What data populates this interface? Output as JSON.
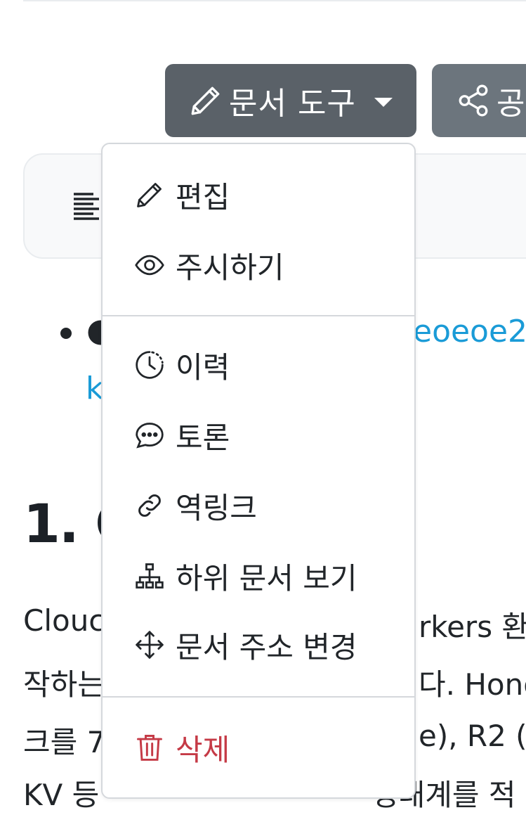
{
  "toolbar": {
    "doc_tools_label": "문서 도구",
    "share_label": "공"
  },
  "content": {
    "link_line1_visible": "eoeoe2",
    "link_line2_visible": "k",
    "heading_visible": "1. C",
    "para_line1_left": "Clouc",
    "para_line1_right": "rkers 환",
    "para_line2_left": "작하는",
    "para_line2_right": "다. Hono",
    "para_line3_left": "크를 7",
    "para_line3_right": "e), R2 (",
    "para_line4_left": "KV 등",
    "para_line4_right": "생태계를 적"
  },
  "menu": {
    "items": [
      {
        "label": "편집",
        "icon": "pencil-icon"
      },
      {
        "label": "주시하기",
        "icon": "eye-icon"
      },
      {
        "label": "이력",
        "icon": "history-clock-icon"
      },
      {
        "label": "토론",
        "icon": "chat-bubble-icon"
      },
      {
        "label": "역링크",
        "icon": "link-icon"
      },
      {
        "label": "하위 문서 보기",
        "icon": "sitemap-icon"
      },
      {
        "label": "문서 주소 변경",
        "icon": "move-arrows-icon"
      },
      {
        "label": "삭제",
        "icon": "trash-icon"
      }
    ]
  },
  "colors": {
    "doc_tools_bg": "#5a6168",
    "share_bg": "#6c757d",
    "link": "#1a9bd7",
    "danger": "#c53a46"
  }
}
